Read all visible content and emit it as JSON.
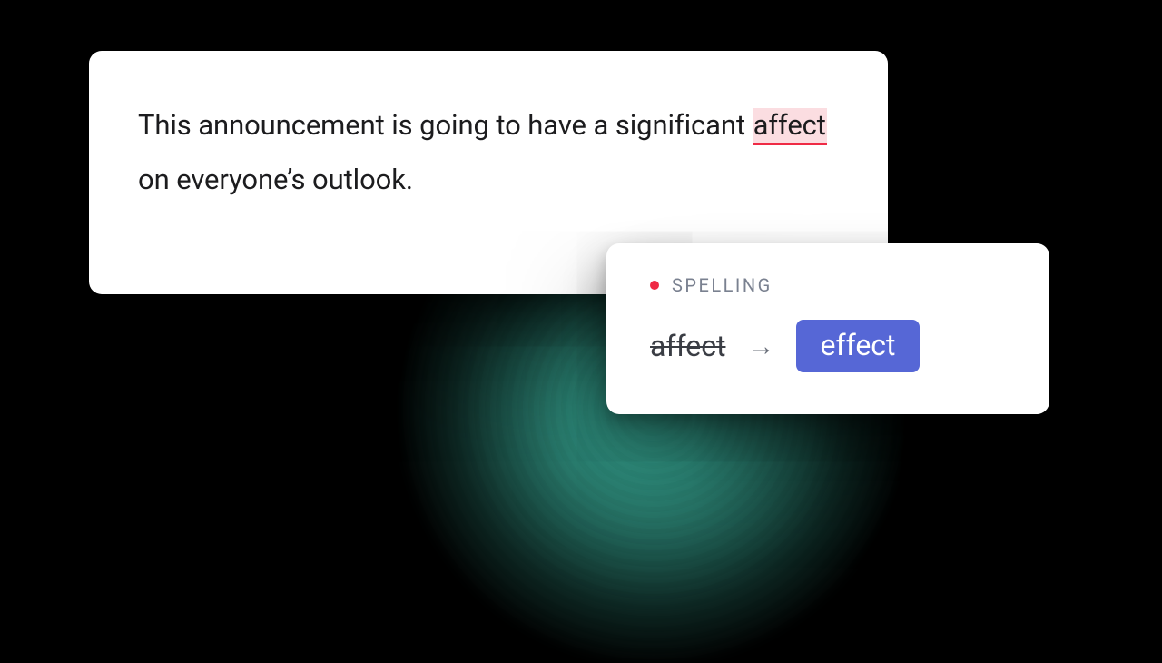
{
  "editor": {
    "sentence_before": "This announcement is going to have a significant ",
    "error_word": "affect",
    "sentence_after": " on everyone’s outlook."
  },
  "suggestion": {
    "category": "SPELLING",
    "original": "affect",
    "replacement": "effect",
    "dot_color": "#ef2a45",
    "button_color": "#5667d6"
  }
}
